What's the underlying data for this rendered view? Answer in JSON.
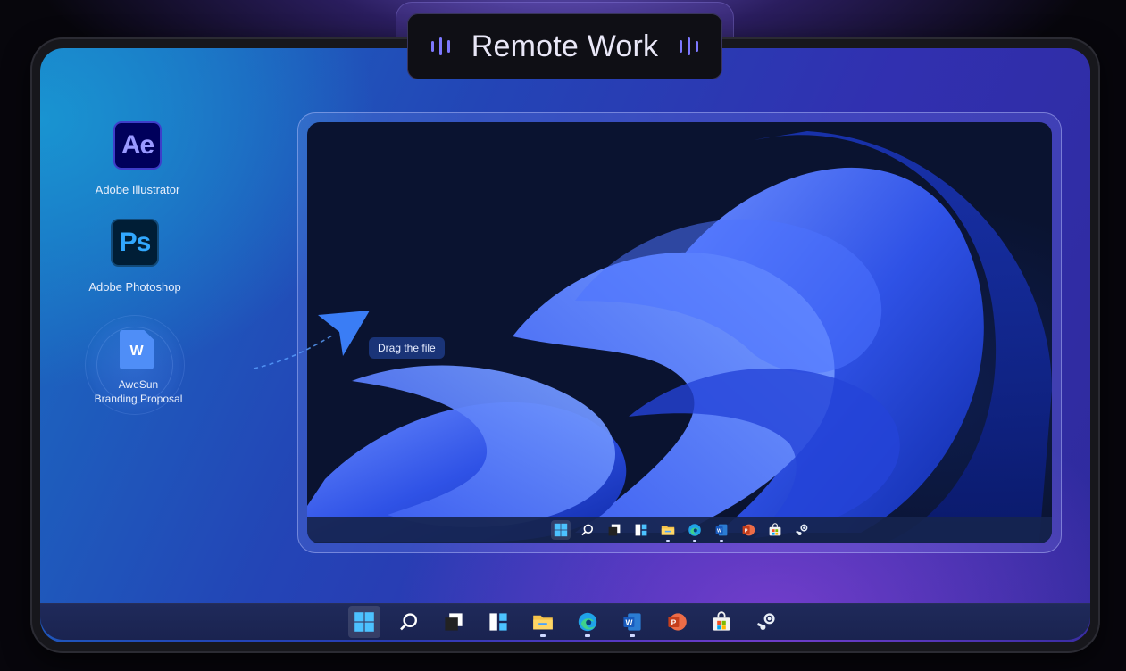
{
  "title": "Remote Work",
  "desktop_icons": [
    {
      "badge": "Ae",
      "label": "Adobe Illustrator",
      "icon": "after-effects-icon"
    },
    {
      "badge": "Ps",
      "label": "Adobe Photoshop",
      "icon": "photoshop-icon"
    },
    {
      "badge": "W",
      "label_line1": "AweSun",
      "label_line2": "Branding Proposal",
      "icon": "word-document-icon"
    }
  ],
  "drag_hint": "Drag the file",
  "taskbar_icons": [
    "windows-start-icon",
    "search-icon",
    "task-view-icon",
    "widgets-icon",
    "file-explorer-icon",
    "edge-icon",
    "word-icon",
    "powerpoint-icon",
    "store-icon",
    "steam-icon"
  ],
  "colors": {
    "accent": "#7d78ff",
    "ae_bg": "#00005b",
    "ps_bg": "#001e36",
    "doc_blue": "#4f8ef7"
  }
}
